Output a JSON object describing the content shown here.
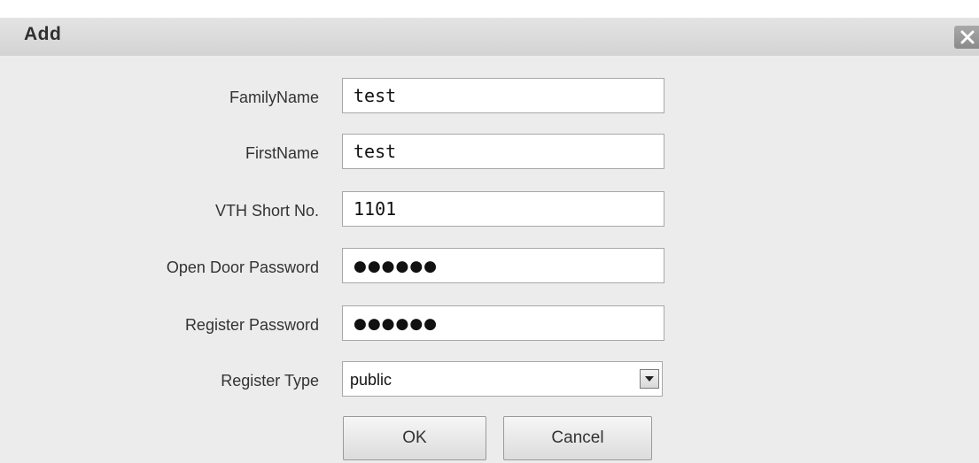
{
  "dialog": {
    "title": "Add"
  },
  "form": {
    "family_name": {
      "label": "FamilyName",
      "value": "test"
    },
    "first_name": {
      "label": "FirstName",
      "value": "test"
    },
    "vth_short_no": {
      "label": "VTH Short No.",
      "value": "1101"
    },
    "open_door_password": {
      "label": "Open Door Password",
      "masked_value": "●●●●●●"
    },
    "register_password": {
      "label": "Register Password",
      "masked_value": "●●●●●●"
    },
    "register_type": {
      "label": "Register Type",
      "selected": "public"
    }
  },
  "actions": {
    "ok_label": "OK",
    "cancel_label": "Cancel"
  },
  "icons": {
    "close": "close-icon",
    "dropdown": "chevron-down-icon"
  },
  "colors": {
    "dialog_background": "#ececec",
    "titlebar": "#d8d8d8",
    "field_border": "#a8a8a8"
  }
}
